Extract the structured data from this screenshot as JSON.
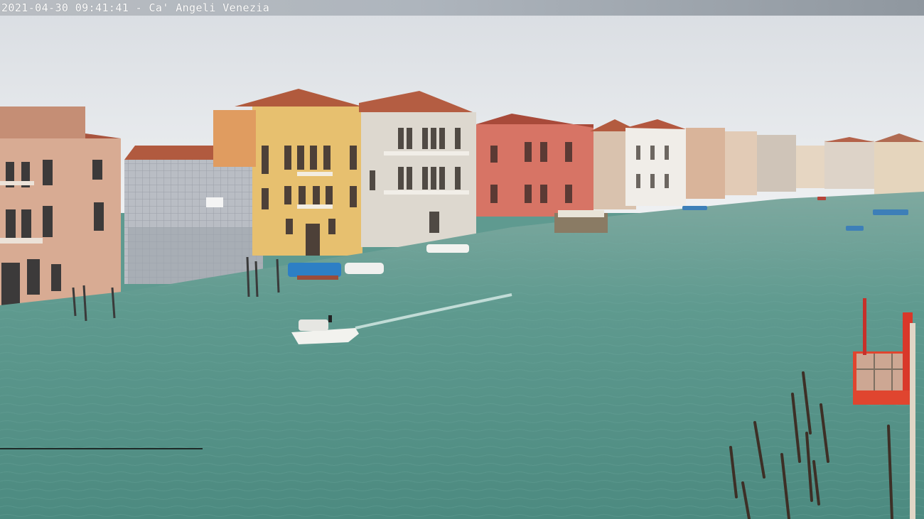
{
  "overlay": {
    "timestamp": "2021-04-30 09:41:41 - Ca' Angeli Venezia"
  },
  "scene": {
    "description_name": "webcam-view",
    "colors": {
      "sky": "#e2e6ea",
      "water": "#5f9a90",
      "water_dark": "#4d8479",
      "timestamp_bar": "#aeb5bd",
      "timestamp_text": "#ffffff"
    }
  }
}
